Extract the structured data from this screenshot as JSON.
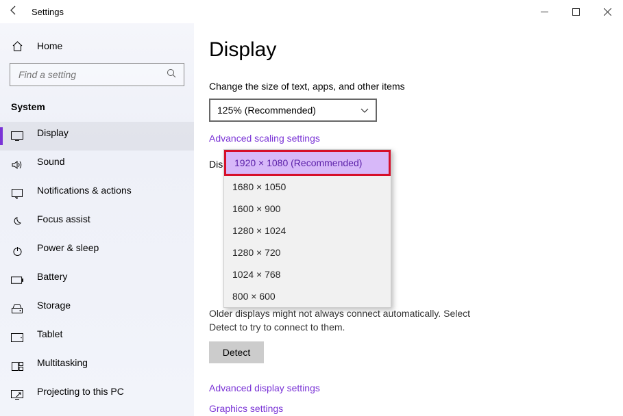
{
  "window": {
    "title": "Settings"
  },
  "sidebar": {
    "home": "Home",
    "search_placeholder": "Find a setting",
    "group": "System",
    "items": [
      {
        "label": "Display"
      },
      {
        "label": "Sound"
      },
      {
        "label": "Notifications & actions"
      },
      {
        "label": "Focus assist"
      },
      {
        "label": "Power & sleep"
      },
      {
        "label": "Battery"
      },
      {
        "label": "Storage"
      },
      {
        "label": "Tablet"
      },
      {
        "label": "Multitasking"
      },
      {
        "label": "Projecting to this PC"
      }
    ]
  },
  "main": {
    "heading": "Display",
    "scale_label": "Change the size of text, apps, and other items",
    "scale_value": "125% (Recommended)",
    "adv_scale_link": "Advanced scaling settings",
    "resolution_label": "Display resolution",
    "resolution_options": [
      "1920 × 1080 (Recommended)",
      "1680 × 1050",
      "1600 × 900",
      "1280 × 1024",
      "1280 × 720",
      "1024 × 768",
      "800 × 600"
    ],
    "older_text": "Older displays might not always connect automatically. Select Detect to try to connect to them.",
    "detect_btn": "Detect",
    "adv_display_link": "Advanced display settings",
    "graphics_link": "Graphics settings"
  }
}
